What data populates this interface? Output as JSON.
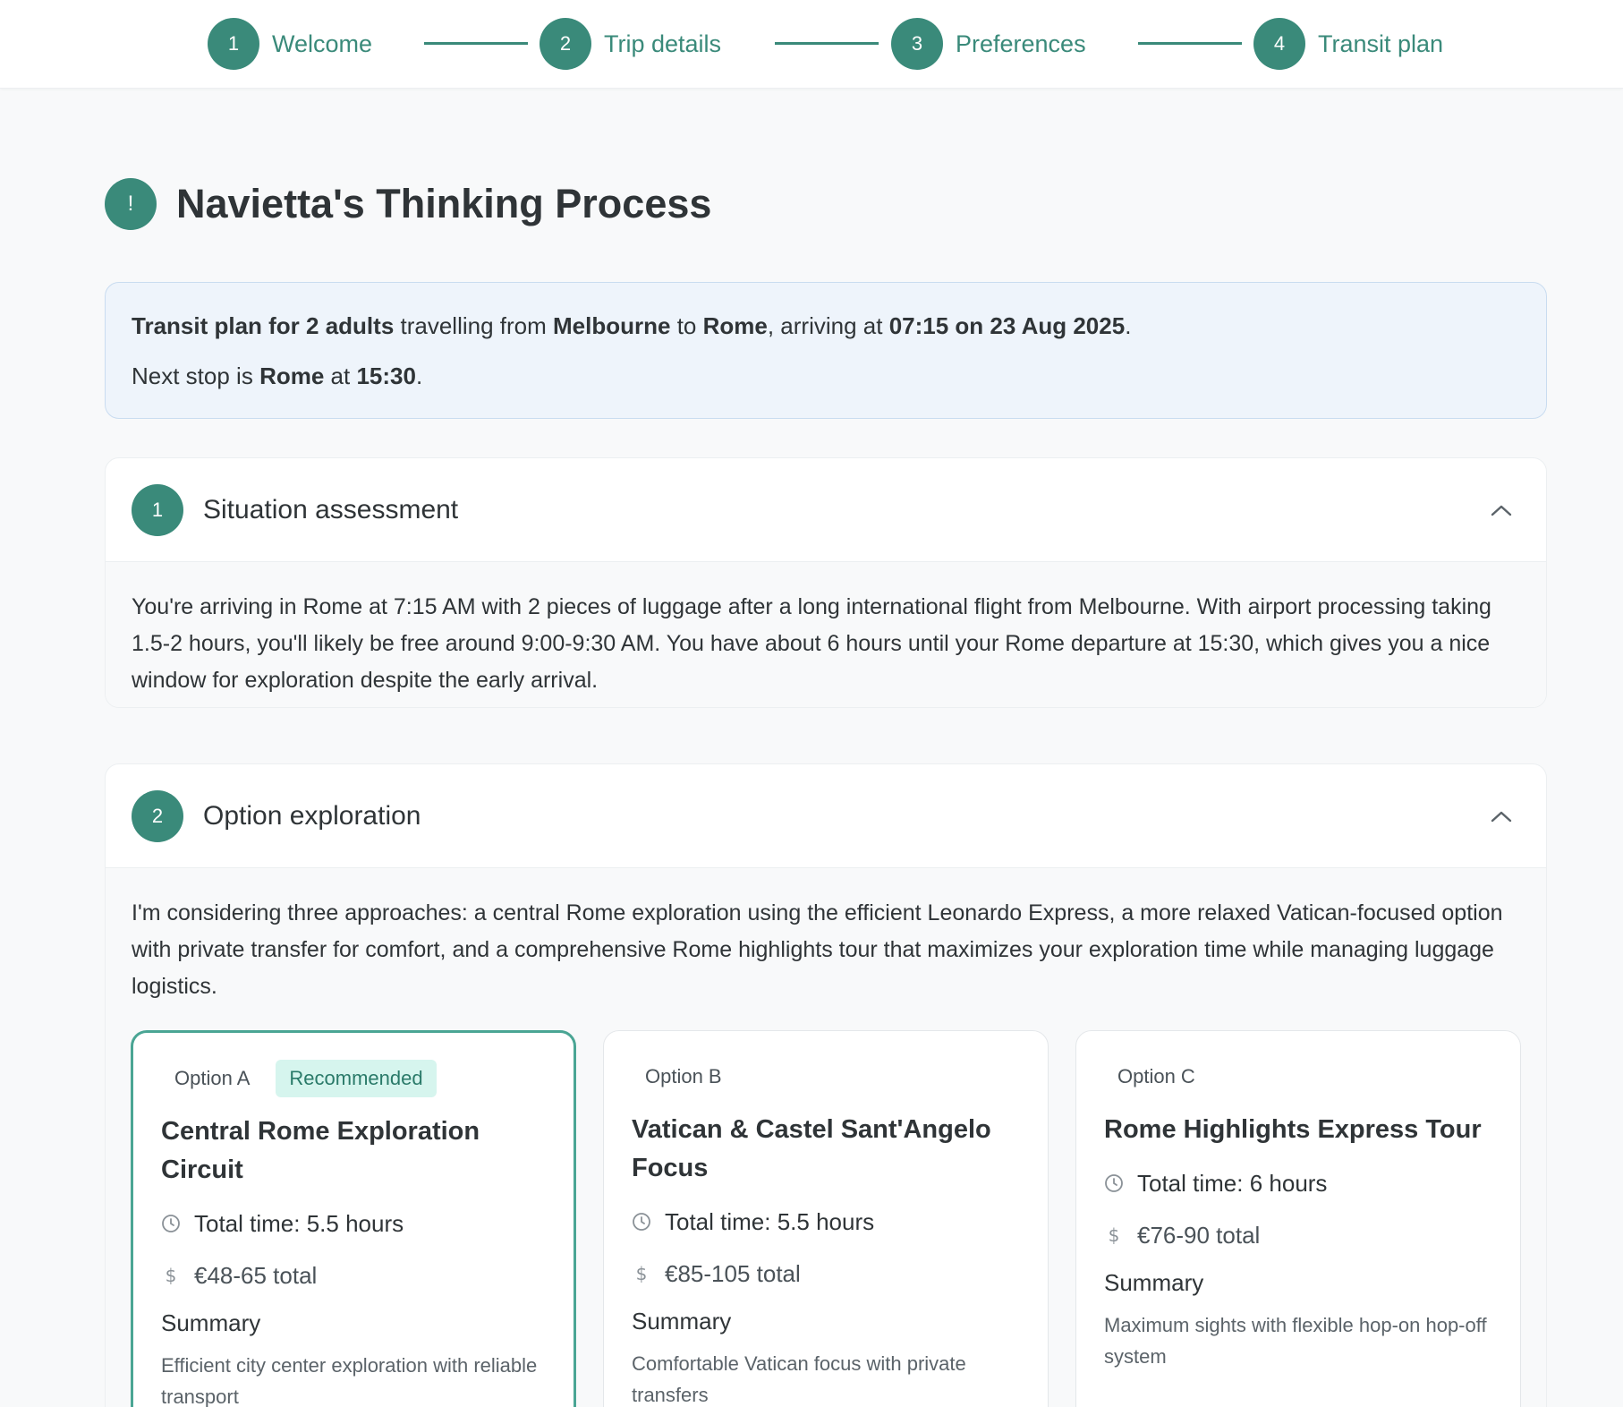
{
  "stepper": {
    "steps": [
      {
        "num": "1",
        "label": "Welcome"
      },
      {
        "num": "2",
        "label": "Trip details"
      },
      {
        "num": "3",
        "label": "Preferences"
      },
      {
        "num": "4",
        "label": "Transit plan"
      }
    ]
  },
  "page": {
    "title_icon": "!",
    "title": "Navietta's Thinking Process"
  },
  "summary": {
    "line1": {
      "a": "Transit plan for 2 adults",
      "b": " travelling from ",
      "c": "Melbourne",
      "d": " to ",
      "e": "Rome",
      "f": ", arriving at ",
      "g": "07:15 on 23 Aug 2025",
      "h": "."
    },
    "line2": {
      "a": "Next stop is ",
      "b": "Rome",
      "c": " at ",
      "d": "15:30",
      "e": "."
    }
  },
  "sections": [
    {
      "num": "1",
      "title": "Situation assessment",
      "body": "You're arriving in Rome at 7:15 AM with 2 pieces of luggage after a long international flight from Melbourne. With airport processing taking 1.5-2 hours, you'll likely be free around 9:00-9:30 AM. You have about 6 hours until your Rome departure at 15:30, which gives you a nice window for exploration despite the early arrival."
    },
    {
      "num": "2",
      "title": "Option exploration",
      "body": "I'm considering three approaches: a central Rome exploration using the efficient Leonardo Express, a more relaxed Vatican-focused option with private transfer for comfort, and a comprehensive Rome highlights tour that maximizes your exploration time while managing luggage logistics."
    }
  ],
  "options": [
    {
      "tag": "Option A",
      "badge": "Recommended",
      "title": "Central Rome Exploration Circuit",
      "time": "Total time: 5.5 hours",
      "price": "€48-65 total",
      "summary_heading": "Summary",
      "summary": "Efficient city center exploration with reliable transport"
    },
    {
      "tag": "Option B",
      "title": "Vatican & Castel Sant'Angelo Focus",
      "time": "Total time: 5.5 hours",
      "price": "€85-105 total",
      "summary_heading": "Summary",
      "summary": "Comfortable Vatican focus with private transfers"
    },
    {
      "tag": "Option C",
      "title": "Rome Highlights Express Tour",
      "time": "Total time: 6 hours",
      "price": "€76-90 total",
      "summary_heading": "Summary",
      "summary": "Maximum sights with flexible hop-on hop-off system"
    }
  ],
  "icons": {
    "clock": "clock-icon",
    "price": "dollar-icon",
    "collapse": "chevron-up-icon"
  },
  "colors": {
    "accent": "#3a8a7a",
    "recommended_border": "#4aa594",
    "badge_bg": "#d6f5ee",
    "summary_bg": "#eef4fb"
  }
}
